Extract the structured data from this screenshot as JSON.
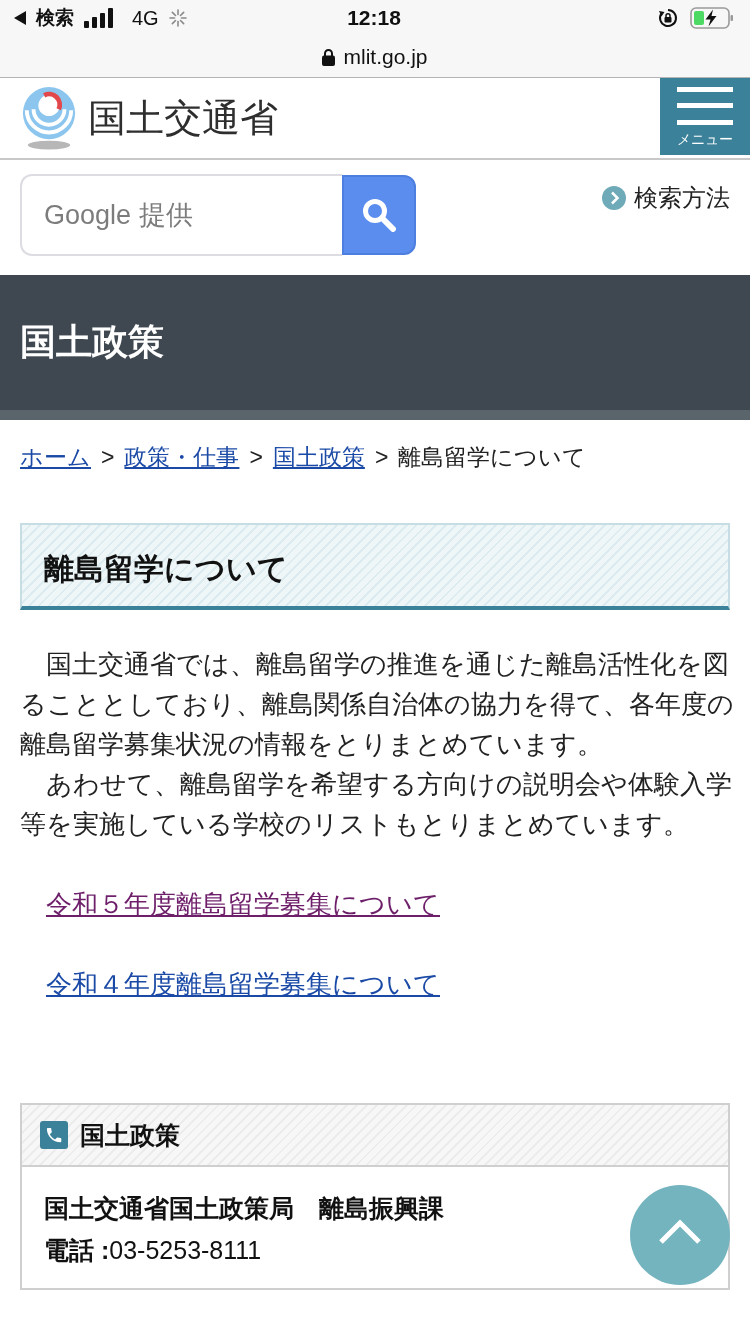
{
  "status_bar": {
    "back_label": "検索",
    "network": "4G",
    "time": "12:18"
  },
  "address_bar": {
    "url": "mlit.go.jp"
  },
  "header": {
    "site_name": "国土交通省",
    "menu_label": "メニュー"
  },
  "search": {
    "placeholder": "Google 提供",
    "help_link": "検索方法"
  },
  "page_title": "国土政策",
  "breadcrumb": [
    {
      "kind": "link",
      "label": "ホーム"
    },
    {
      "kind": "separator",
      "label": ">"
    },
    {
      "kind": "link",
      "label": "政策・仕事"
    },
    {
      "kind": "separator",
      "label": ">"
    },
    {
      "kind": "link",
      "label": "国土政策"
    },
    {
      "kind": "separator",
      "label": ">"
    },
    {
      "kind": "current",
      "label": "離島留学について"
    }
  ],
  "heading": "離島留学について",
  "paragraphs": [
    "国土交通省では、離島留学の推進を通じた離島活性化を図ることとしており、離島関係自治体の協力を得て、各年度の離島留学募集状況の情報をとりまとめています。",
    "あわせて、離島留学を希望する方向けの説明会や体験入学等を実施している学校のリストもとりまとめています。"
  ],
  "links": [
    {
      "label": "令和５年度離島留学募集について",
      "visited": true
    },
    {
      "label": "令和４年度離島留学募集について",
      "visited": false
    }
  ],
  "contact": {
    "title": "国土政策",
    "department": "国土交通省国土政策局　離島振興課",
    "phone": "**電話 :**03-5253-8111"
  }
}
